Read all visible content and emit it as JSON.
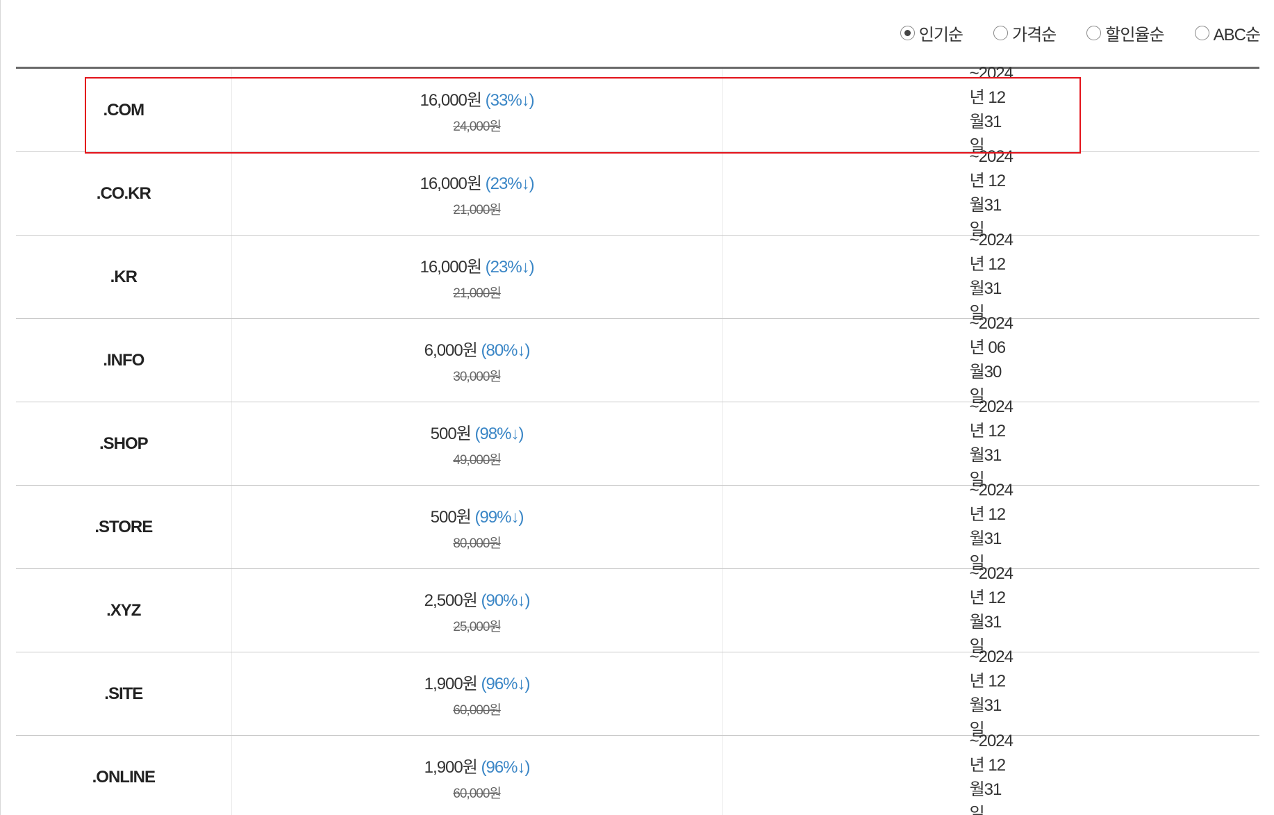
{
  "sort": {
    "options": [
      {
        "label": "인기순",
        "checked": true
      },
      {
        "label": "가격순",
        "checked": false
      },
      {
        "label": "할인율순",
        "checked": false
      },
      {
        "label": "ABC순",
        "checked": false
      }
    ]
  },
  "rows": [
    {
      "domain": ".COM",
      "price": "16,000원",
      "discount": "(33%↓)",
      "original": "24,000원",
      "until": "~2024년 12월31일"
    },
    {
      "domain": ".CO.KR",
      "price": "16,000원",
      "discount": "(23%↓)",
      "original": "21,000원",
      "until": "~2024년 12월31일"
    },
    {
      "domain": ".KR",
      "price": "16,000원",
      "discount": "(23%↓)",
      "original": "21,000원",
      "until": "~2024년 12월31일"
    },
    {
      "domain": ".INFO",
      "price": "6,000원",
      "discount": "(80%↓)",
      "original": "30,000원",
      "until": "~2024년 06월30일"
    },
    {
      "domain": ".SHOP",
      "price": "500원",
      "discount": "(98%↓)",
      "original": "49,000원",
      "until": "~2024년 12월31일"
    },
    {
      "domain": ".STORE",
      "price": "500원",
      "discount": "(99%↓)",
      "original": "80,000원",
      "until": "~2024년 12월31일"
    },
    {
      "domain": ".XYZ",
      "price": "2,500원",
      "discount": "(90%↓)",
      "original": "25,000원",
      "until": "~2024년 12월31일"
    },
    {
      "domain": ".SITE",
      "price": "1,900원",
      "discount": "(96%↓)",
      "original": "60,000원",
      "until": "~2024년 12월31일"
    },
    {
      "domain": ".ONLINE",
      "price": "1,900원",
      "discount": "(96%↓)",
      "original": "60,000원",
      "until": "~2024년 12월31일"
    }
  ],
  "colors": {
    "discount": "#3a86c6",
    "highlight": "#e3121a"
  }
}
